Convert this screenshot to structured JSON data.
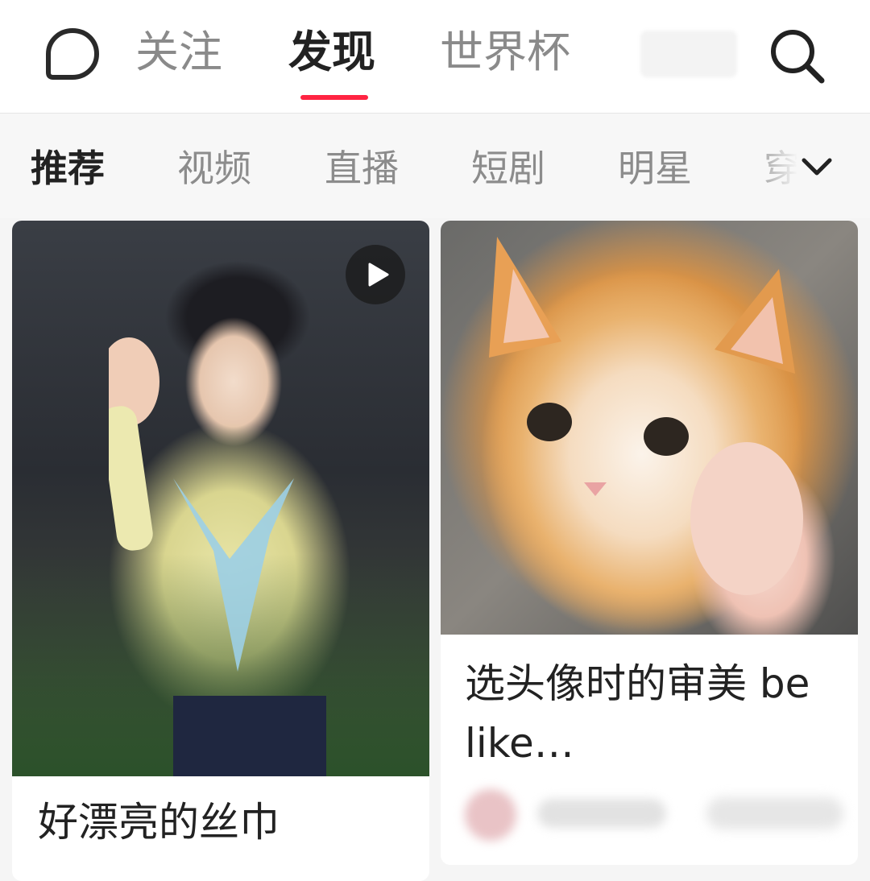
{
  "top_nav": {
    "tabs": [
      {
        "label": "关注",
        "active": false
      },
      {
        "label": "发现",
        "active": true
      },
      {
        "label": "世界杯",
        "active": false
      }
    ],
    "icons": {
      "chat": "chat-bubble-icon",
      "search": "search-icon"
    },
    "accent_color": "#ff2442"
  },
  "categories": {
    "items": [
      "推荐",
      "视频",
      "直播",
      "短剧",
      "明星",
      "穿"
    ],
    "active_index": 0,
    "more_icon": "chevron-down-icon"
  },
  "feed": {
    "cards": [
      {
        "title": "好漂亮的丝巾",
        "is_video": true,
        "video_icon": "play-icon"
      },
      {
        "title": "选头像时的审美 be like…",
        "is_video": false
      }
    ]
  }
}
